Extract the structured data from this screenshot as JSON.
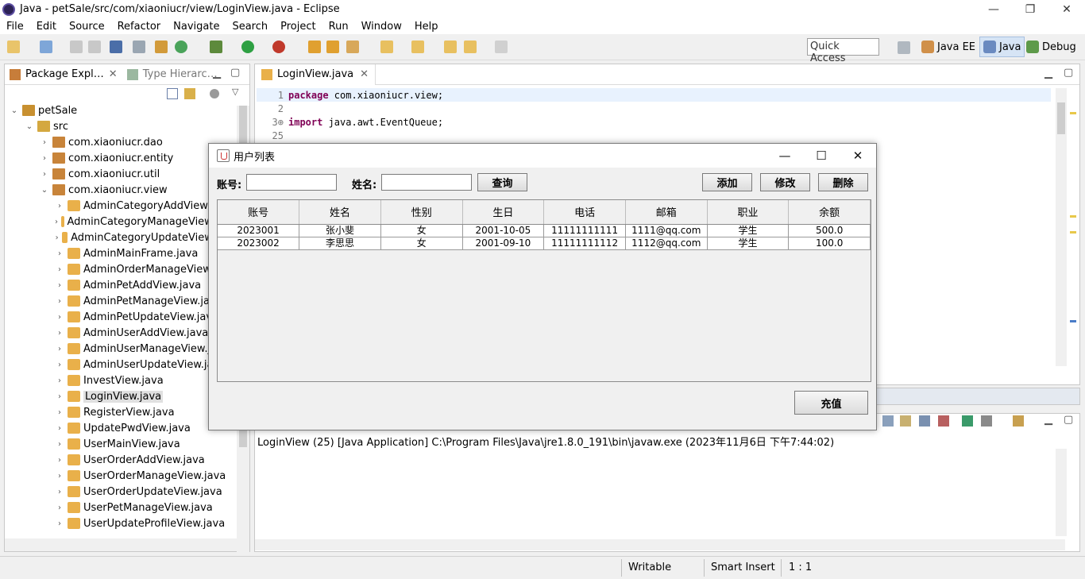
{
  "window": {
    "title": "Java - petSale/src/com/xiaoniucr/view/LoginView.java - Eclipse",
    "controls": [
      "—",
      "❐",
      "✕"
    ]
  },
  "menu": [
    "File",
    "Edit",
    "Source",
    "Refactor",
    "Navigate",
    "Search",
    "Project",
    "Run",
    "Window",
    "Help"
  ],
  "toolbar": {
    "quick_access": "Quick Access",
    "perspectives": [
      "Java EE",
      "Java",
      "Debug"
    ]
  },
  "package_explorer": {
    "tab1": "Package Expl…",
    "tab2": "Type Hierarc…",
    "tree": [
      {
        "label": "petSale",
        "level": 0,
        "arrow": "⌄",
        "icon": "project"
      },
      {
        "label": "src",
        "level": 1,
        "arrow": "⌄",
        "icon": "src-folder"
      },
      {
        "label": "com.xiaoniucr.dao",
        "level": 2,
        "arrow": "›",
        "icon": "package"
      },
      {
        "label": "com.xiaoniucr.entity",
        "level": 2,
        "arrow": "›",
        "icon": "package"
      },
      {
        "label": "com.xiaoniucr.util",
        "level": 2,
        "arrow": "›",
        "icon": "package"
      },
      {
        "label": "com.xiaoniucr.view",
        "level": 2,
        "arrow": "⌄",
        "icon": "package"
      },
      {
        "label": "AdminCategoryAddView.java",
        "level": 3,
        "arrow": "›",
        "icon": "java"
      },
      {
        "label": "AdminCategoryManageView.java",
        "level": 3,
        "arrow": "›",
        "icon": "java"
      },
      {
        "label": "AdminCategoryUpdateView.java",
        "level": 3,
        "arrow": "›",
        "icon": "java"
      },
      {
        "label": "AdminMainFrame.java",
        "level": 3,
        "arrow": "›",
        "icon": "java"
      },
      {
        "label": "AdminOrderManageView.java",
        "level": 3,
        "arrow": "›",
        "icon": "java"
      },
      {
        "label": "AdminPetAddView.java",
        "level": 3,
        "arrow": "›",
        "icon": "java"
      },
      {
        "label": "AdminPetManageView.java",
        "level": 3,
        "arrow": "›",
        "icon": "java"
      },
      {
        "label": "AdminPetUpdateView.java",
        "level": 3,
        "arrow": "›",
        "icon": "java"
      },
      {
        "label": "AdminUserAddView.java",
        "level": 3,
        "arrow": "›",
        "icon": "java"
      },
      {
        "label": "AdminUserManageView.java",
        "level": 3,
        "arrow": "›",
        "icon": "java"
      },
      {
        "label": "AdminUserUpdateView.java",
        "level": 3,
        "arrow": "›",
        "icon": "java"
      },
      {
        "label": "InvestView.java",
        "level": 3,
        "arrow": "›",
        "icon": "java"
      },
      {
        "label": "LoginView.java",
        "level": 3,
        "arrow": "›",
        "icon": "java",
        "selected": true
      },
      {
        "label": "RegisterView.java",
        "level": 3,
        "arrow": "›",
        "icon": "java"
      },
      {
        "label": "UpdatePwdView.java",
        "level": 3,
        "arrow": "›",
        "icon": "java"
      },
      {
        "label": "UserMainView.java",
        "level": 3,
        "arrow": "›",
        "icon": "java"
      },
      {
        "label": "UserOrderAddView.java",
        "level": 3,
        "arrow": "›",
        "icon": "java"
      },
      {
        "label": "UserOrderManageView.java",
        "level": 3,
        "arrow": "›",
        "icon": "java"
      },
      {
        "label": "UserOrderUpdateView.java",
        "level": 3,
        "arrow": "›",
        "icon": "java"
      },
      {
        "label": "UserPetManageView.java",
        "level": 3,
        "arrow": "›",
        "icon": "java"
      },
      {
        "label": "UserUpdateProfileView.java",
        "level": 3,
        "arrow": "›",
        "icon": "java"
      }
    ]
  },
  "editor": {
    "tab": "LoginView.java",
    "lines": [
      {
        "num": "1",
        "kw": "package",
        "rest": " com.xiaoniucr.view;"
      },
      {
        "num": "2",
        "kw": "",
        "rest": ""
      },
      {
        "num": "3⊕",
        "kw": "import",
        "rest": " java.awt.EventQueue;"
      },
      {
        "num": "25",
        "kw": "",
        "rest": ""
      }
    ]
  },
  "console": {
    "text": "LoginView (25) [Java Application] C:\\Program Files\\Java\\jre1.8.0_191\\bin\\javaw.exe (2023年11月6日 下午7:44:02)"
  },
  "statusbar": {
    "writable": "Writable",
    "insert_mode": "Smart Insert",
    "position": "1 : 1"
  },
  "dialog": {
    "title": "用户列表",
    "account_label": "账号:",
    "name_label": "姓名:",
    "query_button": "查询",
    "add_button": "添加",
    "edit_button": "修改",
    "delete_button": "删除",
    "recharge_button": "充值",
    "columns": [
      "账号",
      "姓名",
      "性别",
      "生日",
      "电话",
      "邮箱",
      "职业",
      "余额"
    ],
    "rows": [
      [
        "2023001",
        "张小斐",
        "女",
        "2001-10-05",
        "11111111111",
        "1111@qq.com",
        "学生",
        "500.0"
      ],
      [
        "2023002",
        "李思思",
        "女",
        "2001-09-10",
        "11111111112",
        "1112@qq.com",
        "学生",
        "100.0"
      ]
    ]
  }
}
